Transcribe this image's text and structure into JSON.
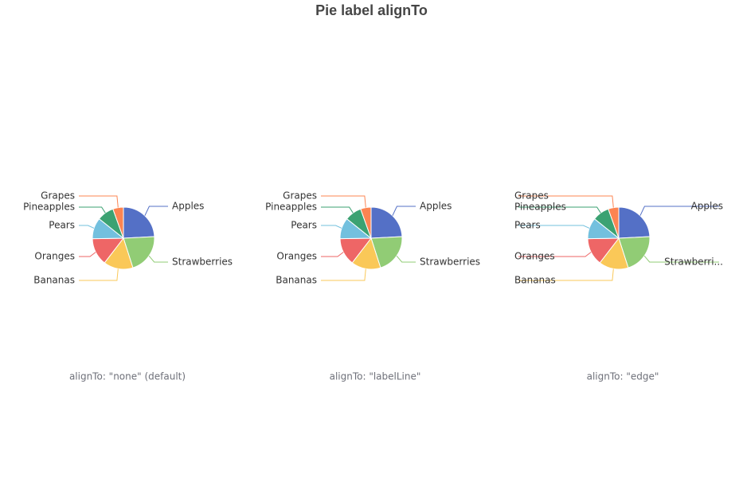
{
  "title": "Pie label alignTo",
  "colors": [
    "#5470c6",
    "#91cc75",
    "#fac858",
    "#ee6666",
    "#73c0de",
    "#3ba272",
    "#fc8452"
  ],
  "chart_data": [
    {
      "type": "pie",
      "subtitle": "alignTo: \"none\" (default)",
      "align_to": "none",
      "categories": [
        "Apples",
        "Strawberries",
        "Bananas",
        "Oranges",
        "Pears",
        "Pineapples",
        "Grapes"
      ],
      "values": [
        22,
        19,
        14,
        13,
        10,
        8,
        5
      ],
      "display_labels": [
        "Apples",
        "Strawberries",
        "Bananas",
        "Oranges",
        "Pears",
        "Pineapples",
        "Grapes"
      ]
    },
    {
      "type": "pie",
      "subtitle": "alignTo: \"labelLine\"",
      "align_to": "labelLine",
      "categories": [
        "Apples",
        "Strawberries",
        "Bananas",
        "Oranges",
        "Pears",
        "Pineapples",
        "Grapes"
      ],
      "values": [
        22,
        19,
        14,
        13,
        10,
        8,
        5
      ],
      "display_labels": [
        "Apples",
        "Strawberries",
        "Bananas",
        "Oranges",
        "Pears",
        "Pineapples",
        "Grapes"
      ]
    },
    {
      "type": "pie",
      "subtitle": "alignTo: \"edge\"",
      "align_to": "edge",
      "categories": [
        "Apples",
        "Strawberries",
        "Bananas",
        "Oranges",
        "Pears",
        "Pineapples",
        "Grapes"
      ],
      "values": [
        22,
        19,
        14,
        13,
        10,
        8,
        5
      ],
      "display_labels": [
        "Apples",
        "Strawberri...",
        "Bananas",
        "Oranges",
        "Pears",
        "Pineapples",
        "Grapes"
      ]
    }
  ]
}
